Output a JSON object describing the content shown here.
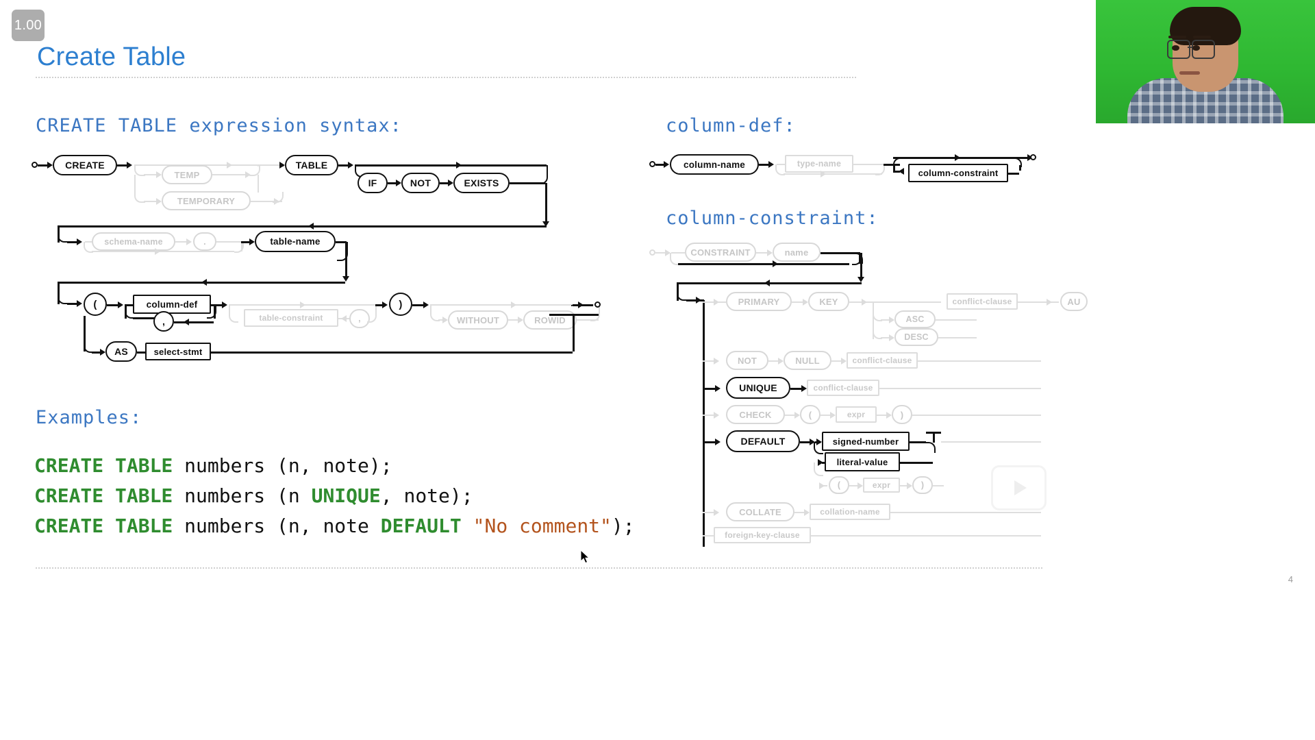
{
  "player": {
    "speed_badge": "1.00",
    "play_icon": "play-icon"
  },
  "slide": {
    "title": "Create Table",
    "page_number": "4"
  },
  "headings": {
    "create_table_syntax": "CREATE TABLE expression syntax:",
    "examples": "Examples:",
    "column_def": "column-def:",
    "column_constraint": "column-constraint:"
  },
  "examples": {
    "lines": [
      [
        {
          "t": "CREATE TABLE",
          "c": "kw"
        },
        {
          "t": " numbers (n, note);",
          "c": ""
        }
      ],
      [
        {
          "t": "CREATE TABLE",
          "c": "kw"
        },
        {
          "t": " numbers (n ",
          "c": ""
        },
        {
          "t": "UNIQUE",
          "c": "kw"
        },
        {
          "t": ", note);",
          "c": ""
        }
      ],
      [
        {
          "t": "CREATE TABLE",
          "c": "kw"
        },
        {
          "t": " numbers (n, note ",
          "c": ""
        },
        {
          "t": "DEFAULT",
          "c": "kw"
        },
        {
          "t": " ",
          "c": ""
        },
        {
          "t": "\"No comment\"",
          "c": "str"
        },
        {
          "t": ");",
          "c": ""
        }
      ]
    ]
  },
  "diagram_create_table": {
    "nodes": [
      {
        "id": "create",
        "label": "CREATE",
        "kind": "terminal",
        "dim": false
      },
      {
        "id": "temp",
        "label": "TEMP",
        "kind": "terminal",
        "dim": true
      },
      {
        "id": "temporary",
        "label": "TEMPORARY",
        "kind": "terminal",
        "dim": true
      },
      {
        "id": "table",
        "label": "TABLE",
        "kind": "terminal",
        "dim": false
      },
      {
        "id": "if",
        "label": "IF",
        "kind": "terminal",
        "dim": false
      },
      {
        "id": "not",
        "label": "NOT",
        "kind": "terminal",
        "dim": false
      },
      {
        "id": "exists",
        "label": "EXISTS",
        "kind": "terminal",
        "dim": false
      },
      {
        "id": "schema-name",
        "label": "schema-name",
        "kind": "terminal",
        "dim": true
      },
      {
        "id": "dot",
        "label": ".",
        "kind": "terminal",
        "dim": true
      },
      {
        "id": "table-name",
        "label": "table-name",
        "kind": "terminal",
        "dim": false
      },
      {
        "id": "lparen",
        "label": "(",
        "kind": "terminal",
        "dim": false
      },
      {
        "id": "column-def",
        "label": "column-def",
        "kind": "nonterminal",
        "dim": false
      },
      {
        "id": "comma1",
        "label": ",",
        "kind": "terminal",
        "dim": false
      },
      {
        "id": "table-constraint",
        "label": "table-constraint",
        "kind": "nonterminal",
        "dim": true
      },
      {
        "id": "comma2",
        "label": ",",
        "kind": "terminal",
        "dim": true
      },
      {
        "id": "rparen",
        "label": ")",
        "kind": "terminal",
        "dim": false
      },
      {
        "id": "without",
        "label": "WITHOUT",
        "kind": "terminal",
        "dim": true
      },
      {
        "id": "rowid",
        "label": "ROWID",
        "kind": "terminal",
        "dim": true
      },
      {
        "id": "as",
        "label": "AS",
        "kind": "terminal",
        "dim": false
      },
      {
        "id": "select-stmt",
        "label": "select-stmt",
        "kind": "nonterminal",
        "dim": false
      }
    ]
  },
  "diagram_column_def": {
    "nodes": [
      {
        "id": "column-name",
        "label": "column-name",
        "kind": "terminal",
        "dim": false
      },
      {
        "id": "type-name",
        "label": "type-name",
        "kind": "nonterminal",
        "dim": true
      },
      {
        "id": "column-constraint",
        "label": "column-constraint",
        "kind": "nonterminal",
        "dim": false
      }
    ]
  },
  "diagram_column_constraint": {
    "nodes": [
      {
        "id": "constraint",
        "label": "CONSTRAINT",
        "kind": "terminal",
        "dim": true
      },
      {
        "id": "name",
        "label": "name",
        "kind": "terminal",
        "dim": true
      },
      {
        "id": "primary",
        "label": "PRIMARY",
        "kind": "terminal",
        "dim": true
      },
      {
        "id": "key",
        "label": "KEY",
        "kind": "terminal",
        "dim": true
      },
      {
        "id": "asc",
        "label": "ASC",
        "kind": "terminal",
        "dim": true
      },
      {
        "id": "desc",
        "label": "DESC",
        "kind": "terminal",
        "dim": true
      },
      {
        "id": "conflict-clause-1",
        "label": "conflict-clause",
        "kind": "nonterminal",
        "dim": true
      },
      {
        "id": "autoincrement",
        "label": "AU",
        "kind": "terminal",
        "dim": true
      },
      {
        "id": "not",
        "label": "NOT",
        "kind": "terminal",
        "dim": true
      },
      {
        "id": "null",
        "label": "NULL",
        "kind": "terminal",
        "dim": true
      },
      {
        "id": "conflict-clause-2",
        "label": "conflict-clause",
        "kind": "nonterminal",
        "dim": true
      },
      {
        "id": "unique",
        "label": "UNIQUE",
        "kind": "terminal",
        "dim": false
      },
      {
        "id": "conflict-clause-3",
        "label": "conflict-clause",
        "kind": "nonterminal",
        "dim": true
      },
      {
        "id": "check",
        "label": "CHECK",
        "kind": "terminal",
        "dim": true
      },
      {
        "id": "check-lparen",
        "label": "(",
        "kind": "terminal",
        "dim": true
      },
      {
        "id": "check-expr",
        "label": "expr",
        "kind": "nonterminal",
        "dim": true
      },
      {
        "id": "check-rparen",
        "label": ")",
        "kind": "terminal",
        "dim": true
      },
      {
        "id": "default",
        "label": "DEFAULT",
        "kind": "terminal",
        "dim": false
      },
      {
        "id": "signed-number",
        "label": "signed-number",
        "kind": "nonterminal",
        "dim": false
      },
      {
        "id": "literal-value",
        "label": "literal-value",
        "kind": "nonterminal",
        "dim": false
      },
      {
        "id": "def-lparen",
        "label": "(",
        "kind": "terminal",
        "dim": true
      },
      {
        "id": "def-expr",
        "label": "expr",
        "kind": "nonterminal",
        "dim": true
      },
      {
        "id": "def-rparen",
        "label": ")",
        "kind": "terminal",
        "dim": true
      },
      {
        "id": "collate",
        "label": "COLLATE",
        "kind": "terminal",
        "dim": true
      },
      {
        "id": "collation-name",
        "label": "collation-name",
        "kind": "nonterminal",
        "dim": true
      },
      {
        "id": "foreign-key-clause",
        "label": "foreign-key-clause",
        "kind": "nonterminal",
        "dim": true
      }
    ]
  },
  "colors": {
    "title_blue": "#2d7fd0",
    "mono_blue": "#3c77c2",
    "keyword_green": "#2f8c2f",
    "string_orange": "#b3541e",
    "badge_grey": "#adadad"
  }
}
